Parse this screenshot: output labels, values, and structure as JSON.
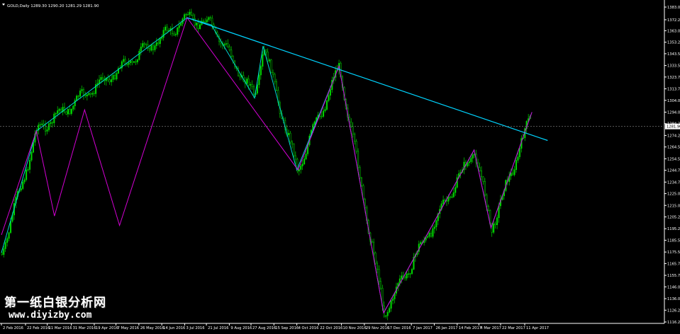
{
  "header": {
    "symbol_info": "GOLD,Daily  1289.30 1290.20 1281.29 1281.90"
  },
  "colors": {
    "background": "#000000",
    "candle_up": "#00d400",
    "candle_down": "#00d400",
    "axis_text": "#ffffff",
    "zigzag_main": "#d400d4",
    "zigzag_secondary": "#00d4d4",
    "trendline": "#00d4ff",
    "price_tag_bg": "#ffffff",
    "price_tag_text": "#000000"
  },
  "price_axis": {
    "labels": [
      "1383.00",
      "1372.25",
      "1363.00",
      "1353.25",
      "1343.50",
      "1333.50",
      "1323.75",
      "1313.75",
      "1304.00",
      "1294.00",
      "1284.25",
      "1274.25",
      "1264.50",
      "1254.50",
      "1244.75",
      "1234.75",
      "1225.00",
      "1215.00",
      "1205.25",
      "1195.25",
      "1185.50",
      "1175.50",
      "1165.75",
      "1155.75",
      "1146.00",
      "1136.00",
      "1126.25",
      "1116.25"
    ],
    "current_price": "1281.90"
  },
  "time_axis": {
    "labels": [
      "2 Feb 2016",
      "22 Feb 2016",
      "11 Mar 2016",
      "31 Mar 2016",
      "19 Apr 2016",
      "7 May 2016",
      "26 May 2016",
      "14 Jun 2016",
      "3 Jul 2016",
      "21 Jul 2016",
      "9 Aug 2016",
      "27 Aug 2016",
      "15 Sep 2016",
      "4 Oct 2016",
      "22 Oct 2016",
      "10 Nov 2016",
      "29 Nov 2016",
      "17 Dec 2016",
      "7 Jan 2017",
      "26 Jan 2017",
      "14 Feb 2017",
      "4 Mar 2017",
      "22 Mar 2017",
      "11 Apr 2017"
    ]
  },
  "watermark": {
    "line1": "第一纸白银分析网",
    "line2": "www.diyizby.com"
  },
  "chart_data": {
    "type": "candlestick",
    "symbol": "GOLD",
    "timeframe": "Daily",
    "ylim": [
      1116.25,
      1383.0
    ],
    "zigzag_main": [
      {
        "date": "2 Feb 2016",
        "price": 1190
      },
      {
        "date": "2 Mar 2016",
        "price": 1278
      },
      {
        "date": "17 Mar 2016",
        "price": 1206
      },
      {
        "date": "11 Apr 2016",
        "price": 1296
      },
      {
        "date": "10 May 2016",
        "price": 1198
      },
      {
        "date": "5 Jul 2016",
        "price": 1374
      },
      {
        "date": "5 Oct 2016",
        "price": 1245
      },
      {
        "date": "8 Nov 2016",
        "price": 1333
      },
      {
        "date": "15 Dec 2016",
        "price": 1124
      },
      {
        "date": "28 Feb 2017",
        "price": 1262
      },
      {
        "date": "14 Mar 2017",
        "price": 1196
      },
      {
        "date": "17 Apr 2017",
        "price": 1294
      }
    ],
    "zigzag_secondary": [
      {
        "date": "2 Feb 2016",
        "price": 1175
      },
      {
        "date": "2 Mar 2016",
        "price": 1278
      },
      {
        "date": "5 Jul 2016",
        "price": 1374
      },
      {
        "date": "25 Jul 2016",
        "price": 1368
      },
      {
        "date": "30 Aug 2016",
        "price": 1306
      },
      {
        "date": "6 Sep 2016",
        "price": 1350
      },
      {
        "date": "4 Oct 2016",
        "price": 1245
      },
      {
        "date": "8 Nov 2016",
        "price": 1333
      },
      {
        "date": "15 Dec 2016",
        "price": 1124
      },
      {
        "date": "28 Feb 2017",
        "price": 1262
      },
      {
        "date": "14 Mar 2017",
        "price": 1196
      },
      {
        "date": "17 Apr 2017",
        "price": 1294
      }
    ],
    "trendline": [
      {
        "date": "5 Jul 2016",
        "price": 1374
      },
      {
        "date": "30 Apr 2017",
        "price": 1270
      }
    ]
  }
}
